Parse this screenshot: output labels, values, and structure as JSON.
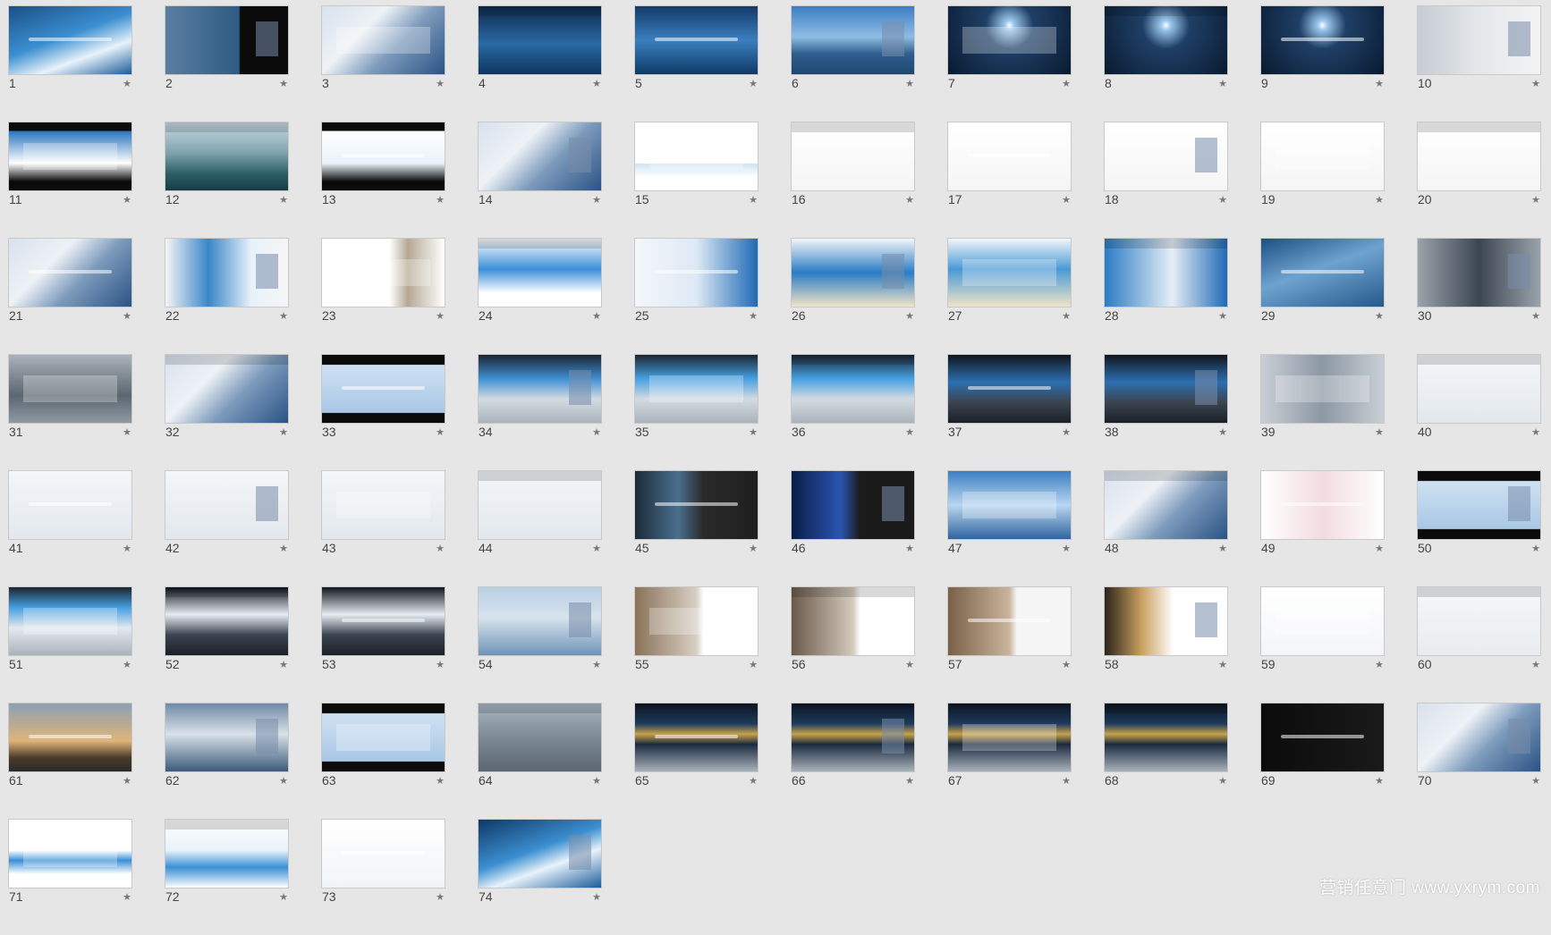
{
  "watermark": "营销任意门 www.yxrym.com",
  "star_icon": "star-icon",
  "slides": [
    {
      "num": "1",
      "bg": "linear-gradient(160deg,#1a4f86 0%,#3b8fd1 45%,#e8f3fb 70%,#1b5c99 100%)"
    },
    {
      "num": "2",
      "bg": "linear-gradient(90deg,#5a7ea0 0%,#2f5a82 60%,#0b0b0b 61%,#0b0b0b 100%)"
    },
    {
      "num": "3",
      "bg": "linear-gradient(135deg,#d8e2ee 0%,#eef2f6 35%,#7d9bbc 60%,#2a5384 100%)"
    },
    {
      "num": "4",
      "bg": "linear-gradient(180deg,#0d2a4e 0%,#2a6aa3 55%,#0e3561 100%)"
    },
    {
      "num": "5",
      "bg": "linear-gradient(180deg,#123a68 0%,#3b7fbf 50%,#0f3a66 100%)"
    },
    {
      "num": "6",
      "bg": "linear-gradient(180deg,#3c7ec4 0%,#8fbde4 45%,#2f5f8f 70%,#1d4770 100%)"
    },
    {
      "num": "7",
      "bg": "radial-gradient(circle at 50% 28%,#ffffff 0%,#9cc7ee 6%,#1f3f66 30%,#081a30 100%)"
    },
    {
      "num": "8",
      "bg": "radial-gradient(circle at 50% 28%,#ffffff 0%,#9cc7ee 6%,#1f3f66 30%,#081a30 100%)"
    },
    {
      "num": "9",
      "bg": "radial-gradient(circle at 50% 28%,#ffffff 0%,#9cc7ee 6%,#1f3f66 30%,#081a30 100%)"
    },
    {
      "num": "10",
      "bg": "linear-gradient(90deg,#c7cdd3 0%,#e4e7ea 50%,#f3f3f3 100%)"
    },
    {
      "num": "11",
      "bg": "linear-gradient(180deg,#0b0b0b 0%,#0b0b0b 12%,#2b76c0 13%,#ffffff 60%,#0b0b0b 87%,#0b0b0b 100%)"
    },
    {
      "num": "12",
      "bg": "linear-gradient(180deg,#c6d9e0 0%,#7fa3ad 45%,#2f5f68 75%,#173c45 100%)"
    },
    {
      "num": "13",
      "bg": "linear-gradient(180deg,#0b0b0b 0%,#0b0b0b 12%,#ffffff 13%,#e9f3fa 60%,#0b0b0b 87%,#0b0b0b 100%)"
    },
    {
      "num": "14",
      "bg": "linear-gradient(135deg,#d8e2ee 0%,#eef2f6 35%,#7d9bbc 60%,#2a5384 100%)"
    },
    {
      "num": "15",
      "bg": "linear-gradient(180deg,#ffffff 0%,#ffffff 60%,#cfe4f4 61%,#ffffff 80%)"
    },
    {
      "num": "16",
      "bg": "linear-gradient(180deg,#ffffff 0%,#f5f5f5 100%)"
    },
    {
      "num": "17",
      "bg": "linear-gradient(180deg,#ffffff 0%,#f5f5f5 100%)"
    },
    {
      "num": "18",
      "bg": "linear-gradient(180deg,#ffffff 0%,#f5f5f5 100%)"
    },
    {
      "num": "19",
      "bg": "linear-gradient(180deg,#ffffff 0%,#f5f5f5 100%)"
    },
    {
      "num": "20",
      "bg": "linear-gradient(180deg,#ffffff 0%,#f5f5f5 100%)"
    },
    {
      "num": "21",
      "bg": "linear-gradient(135deg,#d8e2ee 0%,#eef2f6 35%,#7d9bbc 60%,#2a5384 100%)"
    },
    {
      "num": "22",
      "bg": "linear-gradient(90deg,#f5f5f5 0%,#3a86c8 35%,#e8f2fa 70%,#f5f5f5 100%)"
    },
    {
      "num": "23",
      "bg": "linear-gradient(90deg,#ffffff 0%,#ffffff 55%,#b5a994 70%,#ffffff 100%)"
    },
    {
      "num": "24",
      "bg": "linear-gradient(180deg,#ffffff 0%,#3b8fd8 45%,#ffffff 80%)"
    },
    {
      "num": "25",
      "bg": "linear-gradient(90deg,#f4f7fa 0%,#dde9f5 50%,#1f6ab5 100%)"
    },
    {
      "num": "26",
      "bg": "linear-gradient(180deg,#f3f6f9 0%,#2a7cc5 50%,#f0e4c8 100%)"
    },
    {
      "num": "27",
      "bg": "linear-gradient(180deg,#f3f6f9 0%,#4a9ad6 45%,#f0e4c8 100%)"
    },
    {
      "num": "28",
      "bg": "linear-gradient(90deg,#2a7cc5 0%,#e6eef6 55%,#1f6ab5 100%)"
    },
    {
      "num": "29",
      "bg": "linear-gradient(160deg,#1d4f85 0%,#6fa3cf 45%,#25598c 100%)"
    },
    {
      "num": "30",
      "bg": "linear-gradient(90deg,#9aa3ab 0%,#3c4651 50%,#9aa3ab 100%)"
    },
    {
      "num": "31",
      "bg": "linear-gradient(180deg,#aab2ba 0%,#5a6670 60%,#8f9aa3 100%)"
    },
    {
      "num": "32",
      "bg": "linear-gradient(135deg,#d8e2ee 0%,#eef2f6 35%,#7d9bbc 60%,#2a5384 100%)"
    },
    {
      "num": "33",
      "bg": "linear-gradient(180deg,#0b0b0b 0%,#0b0b0b 14%,#cfe1f2 15%,#a9c7e6 85%,#0b0b0b 86%)"
    },
    {
      "num": "34",
      "bg": "linear-gradient(180deg,#1a2430 0%,#3f8fd3 35%,#d3dbe2 65%,#aab3bc 100%)"
    },
    {
      "num": "35",
      "bg": "linear-gradient(180deg,#1a2430 0%,#46a0e2 35%,#d3dbe2 65%,#aab3bc 100%)"
    },
    {
      "num": "36",
      "bg": "linear-gradient(180deg,#1a2430 0%,#46a0e2 35%,#d3dbe2 65%,#aab3bc 100%)"
    },
    {
      "num": "37",
      "bg": "linear-gradient(180deg,#10151c 0%,#2c6fb0 40%,#3b4450 70%,#1a2028 100%)"
    },
    {
      "num": "38",
      "bg": "linear-gradient(180deg,#10151c 0%,#2c6fb0 40%,#3b4450 70%,#1a2028 100%)"
    },
    {
      "num": "39",
      "bg": "linear-gradient(90deg,#c9cfd5 0%,#8c98a5 50%,#c9cfd5 100%)"
    },
    {
      "num": "40",
      "bg": "linear-gradient(180deg,#f4f6f8 0%,#e3e8ed 100%)"
    },
    {
      "num": "41",
      "bg": "linear-gradient(180deg,#f4f6f8 0%,#e3e8ed 100%)"
    },
    {
      "num": "42",
      "bg": "linear-gradient(180deg,#f4f6f8 0%,#e3e8ed 100%)"
    },
    {
      "num": "43",
      "bg": "linear-gradient(180deg,#f4f6f8 0%,#e3e8ed 100%)"
    },
    {
      "num": "44",
      "bg": "linear-gradient(180deg,#f4f6f8 0%,#e3e8ed 100%)"
    },
    {
      "num": "45",
      "bg": "linear-gradient(90deg,#1c2a38 0%,#4a6f8f 35%,#2a2a2a 56%,#1f1f1f 100%)"
    },
    {
      "num": "46",
      "bg": "linear-gradient(90deg,#0a1d4a 0%,#2a55b0 40%,#1a1a1a 56%,#1a1a1a 100%)"
    },
    {
      "num": "47",
      "bg": "linear-gradient(180deg,#3c7ec4 0%,#b9d6ef 50%,#2f64a0 100%)"
    },
    {
      "num": "48",
      "bg": "linear-gradient(135deg,#d8e2ee 0%,#eef2f6 35%,#7d9bbc 60%,#2a5384 100%)"
    },
    {
      "num": "49",
      "bg": "linear-gradient(90deg,#ffffff 0%,#f3dce0 50%,#ffffff 100%)"
    },
    {
      "num": "50",
      "bg": "linear-gradient(180deg,#0b0b0b 0%,#0b0b0b 14%,#cfe1f2 15%,#a9c7e6 85%,#0b0b0b 86%)"
    },
    {
      "num": "51",
      "bg": "linear-gradient(180deg,#1a2430 0%,#46a0e2 30%,#e5e9ee 60%,#aab3bc 100%)"
    },
    {
      "num": "52",
      "bg": "linear-gradient(180deg,#10151c 0%,#e6ecf2 40%,#3b4450 70%,#1a2028 100%)"
    },
    {
      "num": "53",
      "bg": "linear-gradient(180deg,#10151c 0%,#e6ecf2 40%,#3b4450 70%,#1a2028 100%)"
    },
    {
      "num": "54",
      "bg": "linear-gradient(180deg,#b9cfe3 0%,#d8e3ee 45%,#6f93b8 100%)"
    },
    {
      "num": "55",
      "bg": "linear-gradient(90deg,#8a7258 0%,#d8cfc4 50%,#ffffff 56%,#ffffff 100%)"
    },
    {
      "num": "56",
      "bg": "linear-gradient(90deg,#6a5a4a 0%,#d3c9bd 50%,#ffffff 56%,#ffffff 100%)"
    },
    {
      "num": "57",
      "bg": "linear-gradient(90deg,#7a6048 0%,#c9b59c 50%,#f5f5f5 56%,#f5f5f5 100%)"
    },
    {
      "num": "58",
      "bg": "linear-gradient(90deg,#2a241c 0%,#c9a060 30%,#ffffff 56%,#ffffff 100%)"
    },
    {
      "num": "59",
      "bg": "linear-gradient(180deg,#ffffff 0%,#f3f5f8 100%)"
    },
    {
      "num": "60",
      "bg": "linear-gradient(180deg,#f5f6f7 0%,#e9ecef 100%)"
    },
    {
      "num": "61",
      "bg": "linear-gradient(180deg,#8aa0b5 0%,#e0b47a 55%,#4a3a2a 80%,#2a2a2a 100%)"
    },
    {
      "num": "62",
      "bg": "linear-gradient(180deg,#6f8aa6 0%,#d9e1e9 45%,#3a5a7a 100%)"
    },
    {
      "num": "63",
      "bg": "linear-gradient(180deg,#0b0b0b 0%,#0b0b0b 14%,#cfe1f2 15%,#a9c7e6 85%,#0b0b0b 86%)"
    },
    {
      "num": "64",
      "bg": "linear-gradient(180deg,#a8b6c3 0%,#7d8a95 50%,#5a6670 100%)"
    },
    {
      "num": "65",
      "bg": "linear-gradient(180deg,#0c1420 0%,#1e3a5c 30%,#c9a24a 45%,#1a2a3e 60%,#aab3bc 100%)"
    },
    {
      "num": "66",
      "bg": "linear-gradient(180deg,#0c1420 0%,#1e3a5c 30%,#c9a24a 45%,#1a2a3e 60%,#aab3bc 100%)"
    },
    {
      "num": "67",
      "bg": "linear-gradient(180deg,#0c1420 0%,#1e3a5c 30%,#c9a24a 45%,#1a2a3e 60%,#aab3bc 100%)"
    },
    {
      "num": "68",
      "bg": "linear-gradient(180deg,#0c1420 0%,#1e3a5c 30%,#c9a24a 45%,#1a2a3e 60%,#aab3bc 100%)"
    },
    {
      "num": "69",
      "bg": "linear-gradient(90deg,#0b0b0b 0%,#1a1a1a 100%)"
    },
    {
      "num": "70",
      "bg": "linear-gradient(135deg,#d8e2ee 0%,#eef2f6 35%,#7d9bbc 60%,#2a5384 100%)"
    },
    {
      "num": "71",
      "bg": "linear-gradient(180deg,#ffffff 0%,#ffffff 45%,#3a8fd6 60%,#ffffff 80%)"
    },
    {
      "num": "72",
      "bg": "linear-gradient(180deg,#ffffff 0%,#e8f2fa 45%,#3a8fd6 70%,#ffffff 100%)"
    },
    {
      "num": "73",
      "bg": "linear-gradient(180deg,#ffffff 0%,#f2f4f6 100%)"
    },
    {
      "num": "74",
      "bg": "linear-gradient(160deg,#0f3766 0%,#3b8fd1 45%,#e8f3fb 65%,#1b5c99 100%)"
    }
  ]
}
